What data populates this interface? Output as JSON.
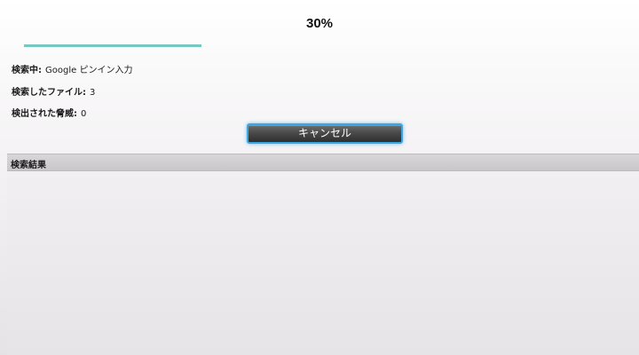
{
  "scan": {
    "percent_label": "30%",
    "progress_fraction": 0.3,
    "progress_color": "#78c8c0",
    "scanning_label": "検索中:",
    "scanning_value": "Google ピンイン入力",
    "files_label": "検索したファイル:",
    "files_value": "3",
    "threats_label": "検出された脅威:",
    "threats_value": "0",
    "cancel_label": "キャンセル",
    "button_border_color": "#3aa6e2"
  },
  "results": {
    "title": "検索結果",
    "items": []
  }
}
